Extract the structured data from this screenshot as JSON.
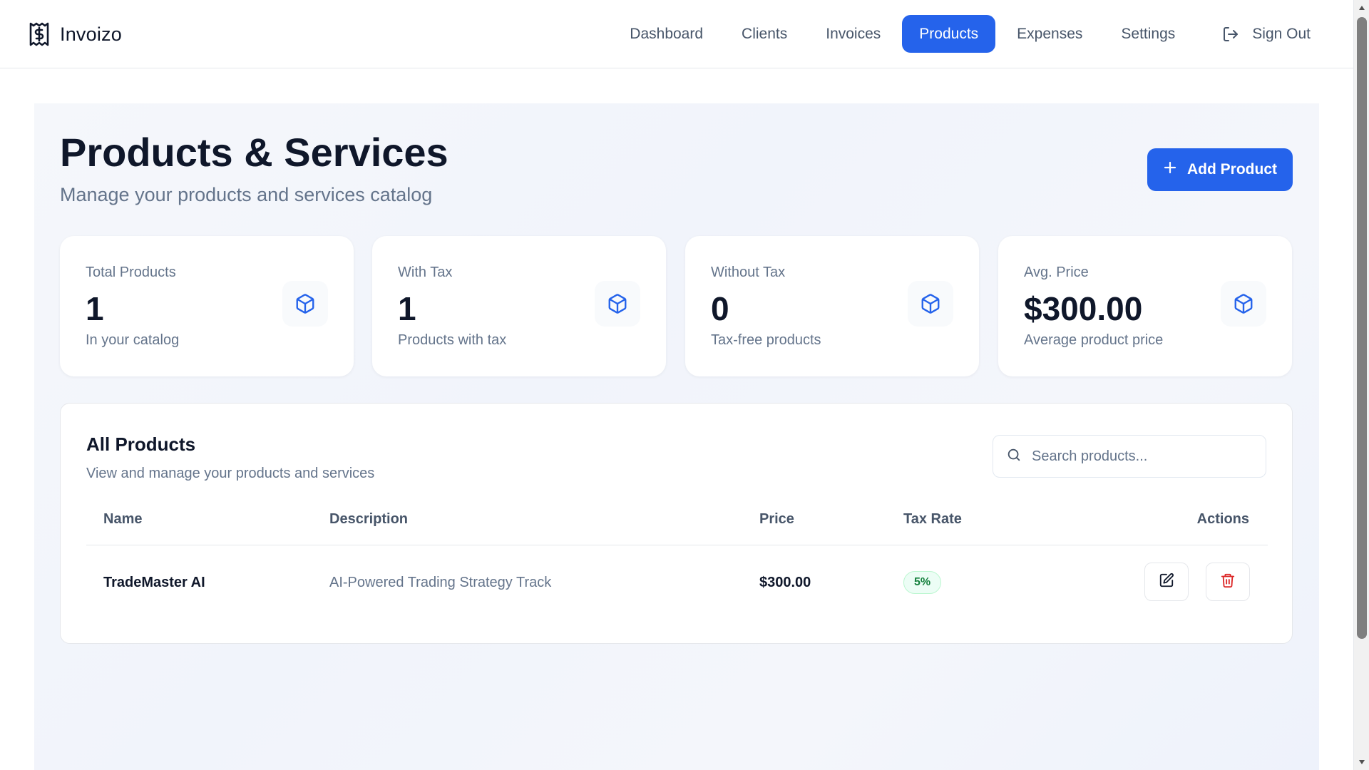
{
  "app": {
    "name": "Invoizo"
  },
  "nav": {
    "items": [
      {
        "label": "Dashboard"
      },
      {
        "label": "Clients"
      },
      {
        "label": "Invoices"
      },
      {
        "label": "Products",
        "active": true
      },
      {
        "label": "Expenses"
      },
      {
        "label": "Settings"
      }
    ],
    "signout_label": "Sign Out"
  },
  "header": {
    "title": "Products & Services",
    "subtitle": "Manage your products and services catalog",
    "add_button_label": "Add Product"
  },
  "stats": [
    {
      "label": "Total Products",
      "value": "1",
      "sub": "In your catalog",
      "icon": "package-icon"
    },
    {
      "label": "With Tax",
      "value": "1",
      "sub": "Products with tax",
      "icon": "package-icon"
    },
    {
      "label": "Without Tax",
      "value": "0",
      "sub": "Tax-free products",
      "icon": "package-icon"
    },
    {
      "label": "Avg. Price",
      "value": "$300.00",
      "sub": "Average product price",
      "icon": "package-icon"
    }
  ],
  "products": {
    "title": "All Products",
    "subtitle": "View and manage your products and services",
    "search": {
      "placeholder": "Search products...",
      "value": ""
    },
    "columns": [
      "Name",
      "Description",
      "Price",
      "Tax Rate",
      "Actions"
    ],
    "rows": [
      {
        "name": "TradeMaster AI",
        "description": "AI-Powered Trading Strategy Track",
        "price": "$300.00",
        "tax_rate": "5%"
      }
    ]
  },
  "colors": {
    "accent": "#2563eb",
    "text": "#0f172a",
    "muted": "#64748b",
    "tax_badge_text": "#15803d",
    "tax_badge_bg": "#ecfdf5",
    "delete": "#dc2626"
  }
}
